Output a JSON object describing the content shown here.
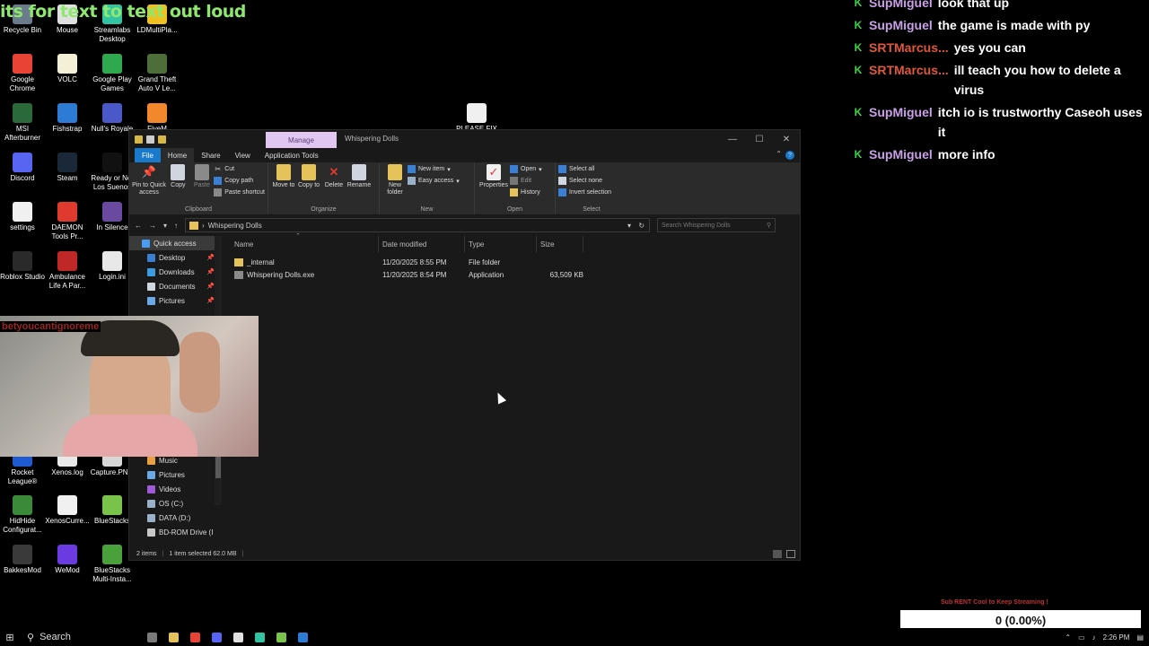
{
  "overlay": {
    "banner": "its for text to text out loud",
    "cam_tag": "betyoucantignoreme",
    "sub_goal": "Sub RENT Cool to Keep Streaming !",
    "counter": "0 (0.00%)"
  },
  "desktop_icons": [
    {
      "label": "Recycle Bin",
      "color": "#6b7b8c"
    },
    {
      "label": "Mouse",
      "color": "#e0e0e0"
    },
    {
      "label": "Streamlabs Desktop",
      "color": "#31c3a2"
    },
    {
      "label": "LDMultiPla...",
      "color": "#f0c020"
    },
    {
      "label": "Google Chrome",
      "color": "#e84335"
    },
    {
      "label": "VOLC",
      "color": "#f4f0d8"
    },
    {
      "label": "Google Play Games",
      "color": "#2fa84f"
    },
    {
      "label": "Grand Theft Auto V Le...",
      "color": "#4d6e38"
    },
    {
      "label": "MSI Afterburner",
      "color": "#2a6a3a"
    },
    {
      "label": "Fishstrap",
      "color": "#2c7cd6"
    },
    {
      "label": "Null's Royale",
      "color": "#4a58c8"
    },
    {
      "label": "FiveM",
      "color": "#f2872b"
    },
    {
      "label": "Discord",
      "color": "#5865f2"
    },
    {
      "label": "Steam",
      "color": "#1b2838"
    },
    {
      "label": "Ready or Not Los Suenos",
      "color": "#111111"
    },
    {
      "label": "settings",
      "color": "#f0f0f0"
    },
    {
      "label": "DAEMON Tools Pr...",
      "color": "#e03a2f"
    },
    {
      "label": "In Silence",
      "color": "#6a4aa0"
    },
    {
      "label": "Roblox Studio",
      "color": "#2a2a2a"
    },
    {
      "label": "Ambulance Life A Par...",
      "color": "#c02828"
    },
    {
      "label": "Login.ini",
      "color": "#e8e8e8"
    },
    {
      "label": "Rocket League®",
      "color": "#1e5bd0"
    },
    {
      "label": "Xenos.log",
      "color": "#e8e8e8"
    },
    {
      "label": "Capture.PN...",
      "color": "#d8d8d8"
    },
    {
      "label": "HidHide Configurat...",
      "color": "#3a8a3a"
    },
    {
      "label": "XenosCurre...",
      "color": "#f0f0f0"
    },
    {
      "label": "BlueStacks",
      "color": "#7ac34a"
    },
    {
      "label": "BakkesMod",
      "color": "#3a3a3a"
    },
    {
      "label": "WeMod",
      "color": "#6b3ae0"
    },
    {
      "label": "BlueStacks Multi-Insta...",
      "color": "#4aa03a"
    },
    {
      "label": "PLEASE FIX",
      "color": "#f0f0f0"
    }
  ],
  "explorer": {
    "manage_tab": "Manage",
    "title": "Whispering Dolls",
    "tabs": [
      "File",
      "Home",
      "Share",
      "View",
      "Application Tools"
    ],
    "ribbon": {
      "clipboard": {
        "name": "Clipboard",
        "pin": "Pin to Quick access",
        "copy": "Copy",
        "paste": "Paste",
        "cut": "Cut",
        "copy_path": "Copy path",
        "paste_shortcut": "Paste shortcut"
      },
      "organize": {
        "name": "Organize",
        "move": "Move to",
        "copy": "Copy to",
        "delete": "Delete",
        "rename": "Rename"
      },
      "new": {
        "name": "New",
        "new_folder": "New folder",
        "new_item": "New item",
        "easy_access": "Easy access"
      },
      "open": {
        "name": "Open",
        "properties": "Properties",
        "open": "Open",
        "edit": "Edit",
        "history": "History"
      },
      "select": {
        "name": "Select",
        "all": "Select all",
        "none": "Select none",
        "invert": "Invert selection"
      }
    },
    "address": "Whispering Dolls",
    "search_placeholder": "Search Whispering Dolls",
    "nav": [
      {
        "label": "Quick access",
        "pin": false,
        "color": "#4a9cf0"
      },
      {
        "label": "Desktop",
        "pin": true,
        "color": "#3b7fd4"
      },
      {
        "label": "Downloads",
        "pin": true,
        "color": "#3b9be0"
      },
      {
        "label": "Documents",
        "pin": true,
        "color": "#cfd6e0"
      },
      {
        "label": "Pictures",
        "pin": true,
        "color": "#6aa8e8"
      }
    ],
    "nav_lower": [
      {
        "label": "Music",
        "color": "#e8a040"
      },
      {
        "label": "Pictures",
        "color": "#6aa8e8"
      },
      {
        "label": "Videos",
        "color": "#a05ad8"
      },
      {
        "label": "OS (C:)",
        "color": "#9ab0c8"
      },
      {
        "label": "DATA (D:)",
        "color": "#9ab0c8"
      },
      {
        "label": "BD-ROM Drive (I",
        "color": "#c8c8c8"
      }
    ],
    "columns": [
      "Name",
      "Date modified",
      "Type",
      "Size"
    ],
    "rows": [
      {
        "name": "_internal",
        "date": "11/20/2025 8:55 PM",
        "type": "File folder",
        "size": ""
      },
      {
        "name": "Whispering Dolls.exe",
        "date": "11/20/2025 8:54 PM",
        "type": "Application",
        "size": "63,509 KB"
      }
    ],
    "status": {
      "items": "2 items",
      "selected": "1 item selected  62.0 MB"
    }
  },
  "chat": [
    {
      "user": "SupMiguel",
      "color": "#c9a0e8",
      "text": "look that up"
    },
    {
      "user": "SupMiguel",
      "color": "#c9a0e8",
      "text": "the game is made with py"
    },
    {
      "user": "SRTMarcus...",
      "color": "#e0573a",
      "text": "yes you can"
    },
    {
      "user": "SRTMarcus...",
      "color": "#e0573a",
      "text": "ill teach you how to delete a virus"
    },
    {
      "user": "SupMiguel",
      "color": "#c9a0e8",
      "text": "itch io is trustworthy Caseoh uses it"
    },
    {
      "user": "SupMiguel",
      "color": "#c9a0e8",
      "text": "more info"
    }
  ],
  "taskbar": {
    "search": "Search",
    "time": "2:26 PM",
    "apps": [
      "#7a7a7a",
      "#e6c25a",
      "#e84335",
      "#5865f2",
      "#e0e0e0",
      "#31c3a2",
      "#7ac34a",
      "#2c7cd6"
    ]
  }
}
